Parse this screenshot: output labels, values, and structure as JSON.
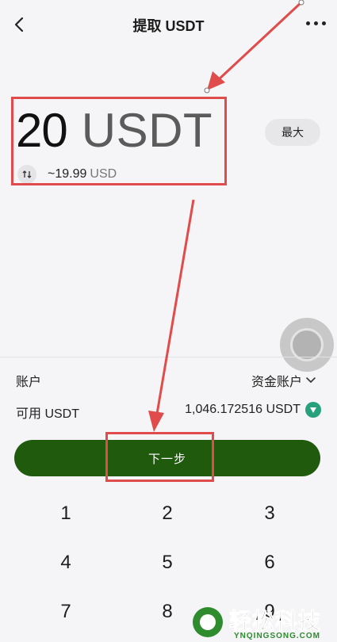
{
  "header": {
    "title": "提取 USDT"
  },
  "amount": {
    "value": "20",
    "currency": "USDT",
    "max_label": "最大",
    "usd_approx": "~19.99",
    "usd_unit": "USD"
  },
  "account": {
    "label": "账户",
    "value": "资金账户"
  },
  "available": {
    "label": "可用 USDT",
    "value": "1,046.172516 USDT"
  },
  "next_button": {
    "label": "下一步"
  },
  "keypad": {
    "keys": [
      "1",
      "2",
      "3",
      "4",
      "5",
      "6",
      "7",
      "8",
      "9"
    ]
  },
  "watermark": {
    "brand": "轻松科技",
    "domain": "YNQINGSONG.COM"
  },
  "colors": {
    "accent": "#1f5a0d",
    "highlight": "#e04b4b",
    "token": "#26a17b"
  }
}
